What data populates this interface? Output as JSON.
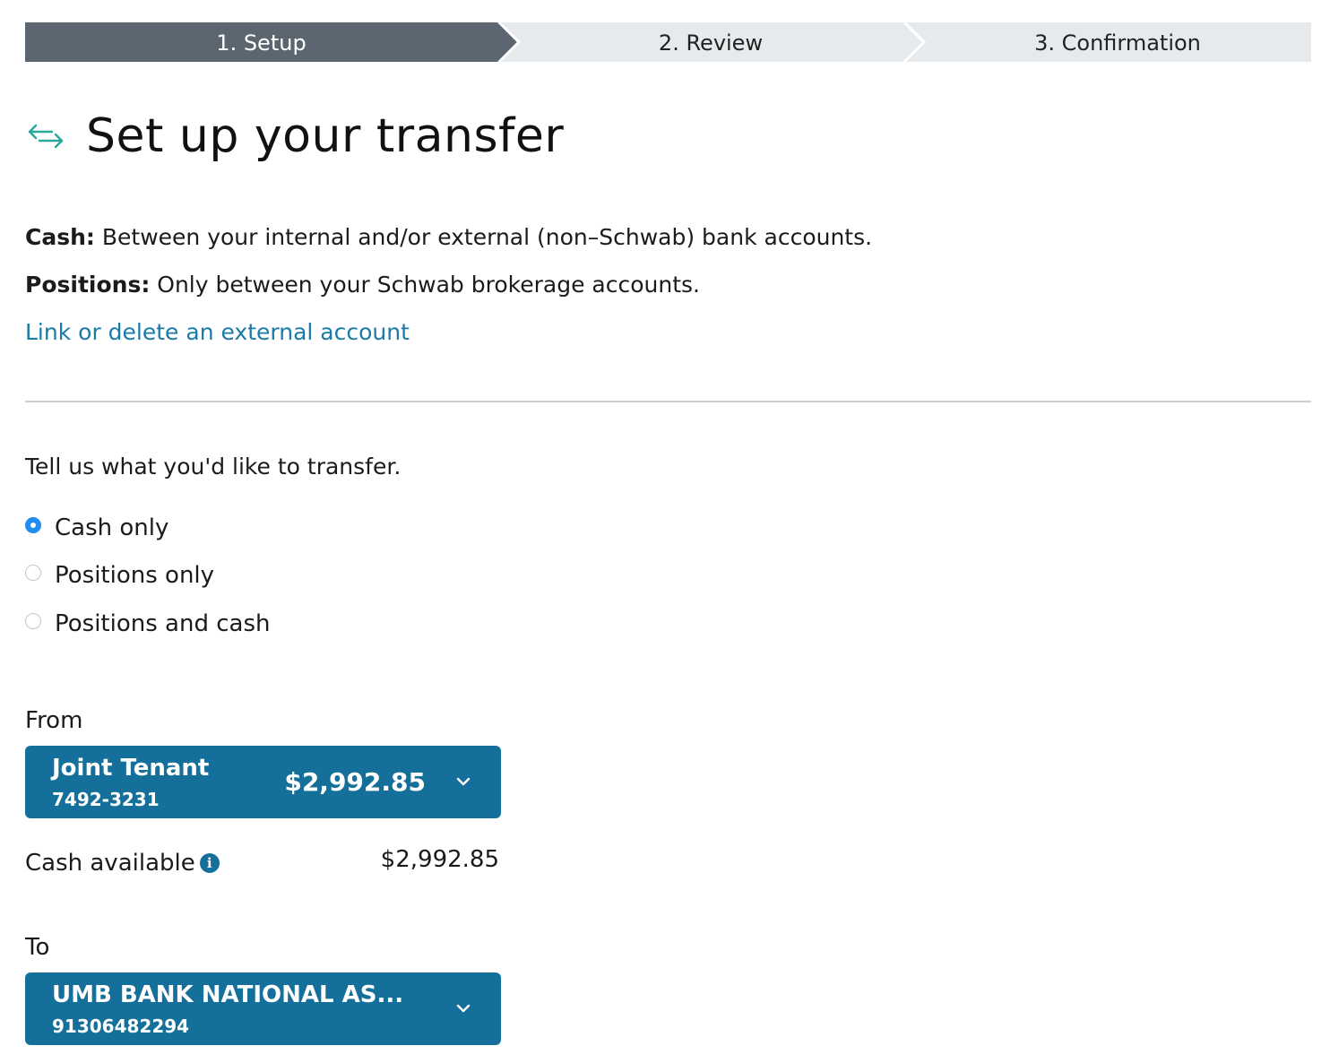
{
  "stepper": {
    "steps": [
      {
        "label": "1. Setup",
        "active": true
      },
      {
        "label": "2. Review",
        "active": false
      },
      {
        "label": "3. Confirmation",
        "active": false
      }
    ],
    "active_color": "#5b6670",
    "inactive_color": "#e7eaec"
  },
  "header": {
    "icon": "transfer-arrows-icon",
    "title": "Set up your transfer"
  },
  "info": {
    "cash_label": "Cash:",
    "cash_text": "Between your internal and/or external (non–Schwab) bank accounts.",
    "positions_label": "Positions:",
    "positions_text": "Only between your Schwab brokerage accounts.",
    "link": "Link or delete an external account"
  },
  "transfer_type": {
    "prompt": "Tell us what you'd like to transfer.",
    "options": [
      {
        "label": "Cash only",
        "selected": true
      },
      {
        "label": "Positions only",
        "selected": false
      },
      {
        "label": "Positions and cash",
        "selected": false
      }
    ]
  },
  "from": {
    "label": "From",
    "account_name": "Joint Tenant",
    "account_number": "7492-3231",
    "balance": "$2,992.85",
    "cash_available_label": "Cash available",
    "cash_available_value": "$2,992.85"
  },
  "to": {
    "label": "To",
    "account_name": "UMB BANK NATIONAL AS...",
    "account_number": "91306482294"
  },
  "colors": {
    "accent": "#14709a",
    "link": "#1a7aa8",
    "radio_selected": "#1e8ef0"
  }
}
